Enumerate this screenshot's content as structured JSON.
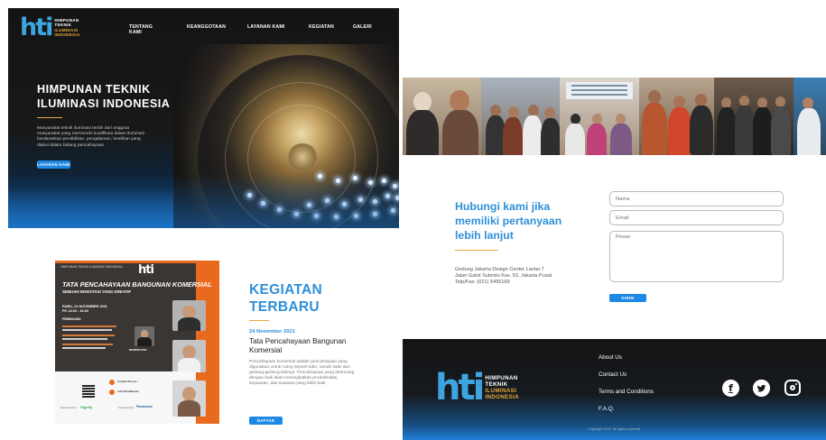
{
  "brand": {
    "mark": "hti",
    "lines": [
      "HIMPUNAN",
      "TEKNIK",
      "ILUMINASI",
      "INDONESIA"
    ],
    "accent": "#3da4e0",
    "gold": "#e8a93a"
  },
  "nav": {
    "items": [
      "TENTANG KAMI",
      "KEANGGOTAAN",
      "LAYANAN KAMI",
      "KEGIATAN",
      "GALERI"
    ]
  },
  "hero": {
    "title": "HIMPUNAN TEKNIK ILUMINASI INDONESIA",
    "description": "Masyarakat teknik iluminasi terdiri dari anggota masyarakat yang memenuhi kualifikasi dalam iluminasi berdasarkan pendidikan, pengalaman, keahlian yang diakui dalam bidang pencahayaan",
    "button": "LAYANAN KAMI"
  },
  "contact": {
    "title": "Hubungi kami jika memiliki pertanyaan lebih lanjut",
    "address_lines": [
      "Gedung Jakarta Design Center Lantai 7",
      "Jalan Gatot Subroto Kav. 53, Jakarta Pusat",
      "Telp/Fax: (021) 5495169"
    ],
    "form": {
      "name_placeholder": "Nama",
      "email_placeholder": "Email",
      "message_placeholder": "Pesan",
      "submit": "KIRIM"
    }
  },
  "poster": {
    "header": "HIMPUNAN TEKNIK ILUMINASI INDONESIA",
    "title": "TATA PENCAHAYAAN BANGUNAN KOMERSIAL",
    "subtitle": "SEBUAH INVESTASI YANG KREATIF",
    "date_line1": "RABU, 24 NOVEMBER 2021",
    "date_line2": "PK 13.00 - 16.30",
    "speakers_label": "PEMBICARA",
    "moderator_label": "MODERATOR",
    "contact_label": "Contact Person :",
    "registration_label": "Link Pendaftaran :",
    "sponsor_label": "Sponsored by",
    "sponsor_name": "Signify",
    "supported_label": "Supported by",
    "supporter_name": "Panasonic"
  },
  "event": {
    "section_title": "KEGIATAN TERBARU",
    "date": "24 November 2021",
    "name": "Tata Pencahayaan Bangunan Komersial",
    "description": "Pencahayaan komersial adalah pencahayaan yang digunakan untuk ruang seperti toko, rumah sakit dan gedung-gedung lainnya. Pencahayaan yang dirancang dengan baik akan meningkatkan produktivitas, kepuasan, dan suasana yang lebih baik.",
    "button": "DAFTAR"
  },
  "footer": {
    "links": [
      "About Us",
      "Contact Us",
      "Terms and Conditions",
      "F.A.Q."
    ],
    "copyright": "Copyright 2021. All rights reserved",
    "social": [
      {
        "name": "facebook-icon",
        "glyph": "f"
      },
      {
        "name": "twitter-icon",
        "glyph": "🐦"
      },
      {
        "name": "instagram-icon",
        "glyph": ""
      }
    ]
  }
}
